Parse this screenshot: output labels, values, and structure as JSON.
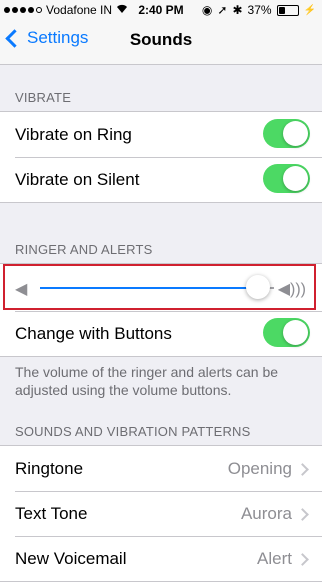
{
  "status_bar": {
    "carrier": "Vodafone IN",
    "time": "2:40 PM",
    "battery_percent": "37%",
    "battery_level": 0.37
  },
  "nav": {
    "back_label": "Settings",
    "title": "Sounds"
  },
  "vibrate": {
    "header": "VIBRATE",
    "items": [
      {
        "label": "Vibrate on Ring",
        "on": true
      },
      {
        "label": "Vibrate on Silent",
        "on": true
      }
    ]
  },
  "ringer": {
    "header": "RINGER AND ALERTS",
    "volume_level": 0.93,
    "change_with_buttons_label": "Change with Buttons",
    "change_with_buttons_on": true,
    "footer": "The volume of the ringer and alerts can be adjusted using the volume buttons."
  },
  "patterns": {
    "header": "SOUNDS AND VIBRATION PATTERNS",
    "items": [
      {
        "label": "Ringtone",
        "value": "Opening"
      },
      {
        "label": "Text Tone",
        "value": "Aurora"
      },
      {
        "label": "New Voicemail",
        "value": "Alert"
      }
    ]
  },
  "accent_color": "#0a7aff",
  "toggle_color": "#4cd964",
  "highlight_color": "#d0202f"
}
